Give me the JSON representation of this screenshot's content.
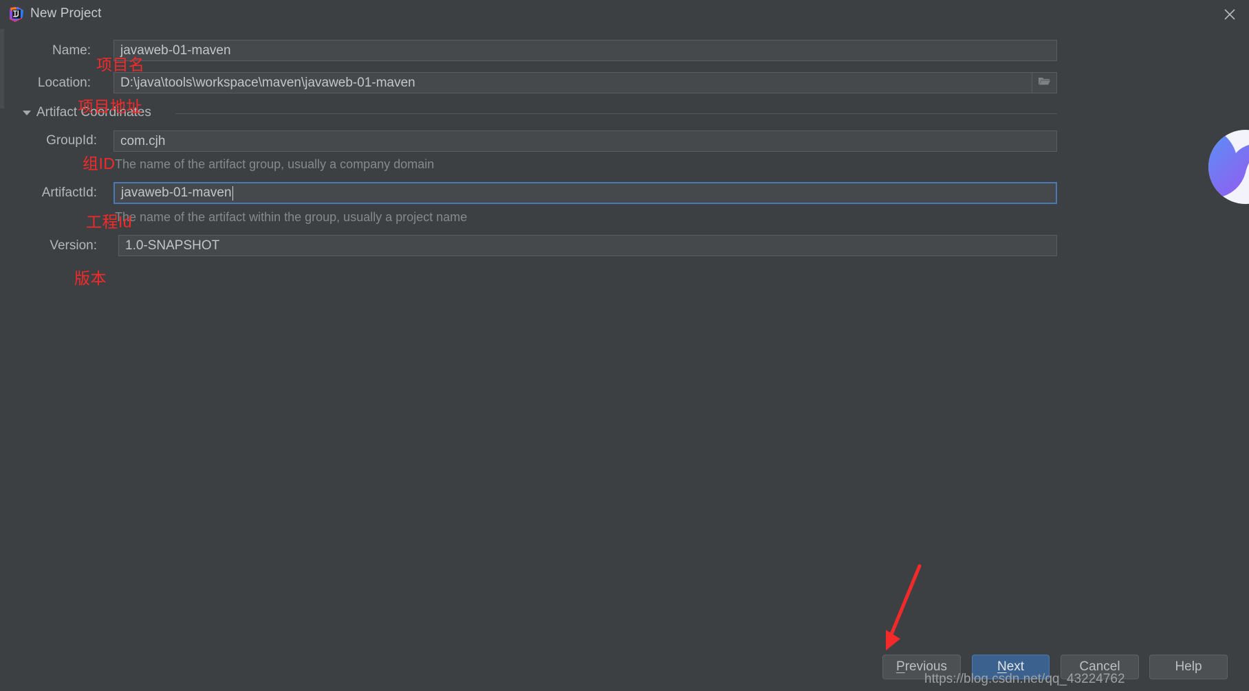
{
  "window": {
    "title": "New Project",
    "app_icon": "intellij-idea-icon",
    "close_label": "✕"
  },
  "form": {
    "name": {
      "label": "Name:",
      "value": "javaweb-01-maven"
    },
    "location": {
      "label": "Location:",
      "value": "D:\\java\\tools\\workspace\\maven\\javaweb-01-maven",
      "browse_icon": "folder-icon"
    },
    "section": {
      "title": "Artifact Coordinates",
      "expanded": true,
      "toggle_icon": "triangle-down-icon"
    },
    "group_id": {
      "label": "GroupId:",
      "value": "com.cjh",
      "hint": "The name of the artifact group, usually a company domain"
    },
    "artifact_id": {
      "label": "ArtifactId:",
      "value": "javaweb-01-maven",
      "hint": "The name of the artifact within the group, usually a project name",
      "focused": true
    },
    "version": {
      "label": "Version:",
      "value": "1.0-SNAPSHOT"
    }
  },
  "buttons": {
    "previous": {
      "label": "Previous",
      "mnemonic": "P"
    },
    "next": {
      "label": "Next",
      "mnemonic": "N",
      "primary": true
    },
    "cancel": {
      "label": "Cancel"
    },
    "help": {
      "label": "Help"
    }
  },
  "annotations": [
    {
      "text": "项目名",
      "meaning": "project-name"
    },
    {
      "text": "项目地址",
      "meaning": "project-location"
    },
    {
      "text": "组ID",
      "meaning": "group-id"
    },
    {
      "text": "工程Id",
      "meaning": "artifact-id"
    },
    {
      "text": "版本",
      "meaning": "version"
    }
  ],
  "watermark": "https://blog.csdn.net/qq_43224762",
  "colors": {
    "window_bg": "#3c4043",
    "field_bg": "#45494c",
    "focus_border": "#4b79b5",
    "primary_button": "#3b618f",
    "annotation_red": "#f42a2a"
  }
}
